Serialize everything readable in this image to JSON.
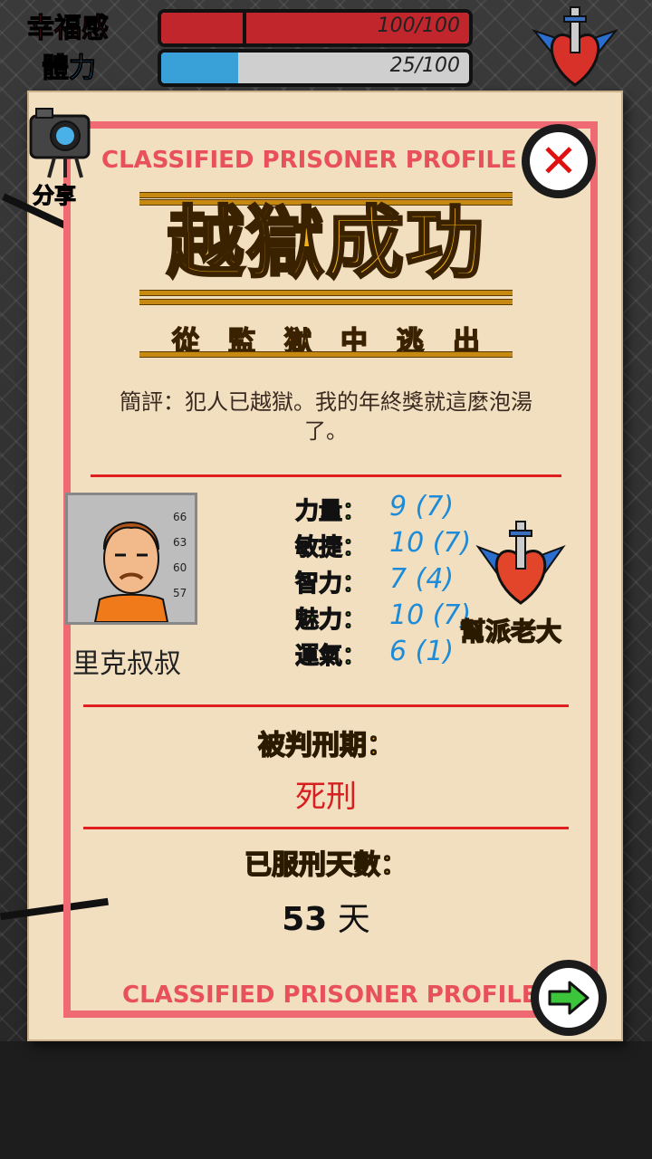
{
  "hud": {
    "stats": [
      {
        "label": "幸福感",
        "value_text": "100/100",
        "fraction": 1.0,
        "color": "#c0262c"
      },
      {
        "label": "體力",
        "value_text": "25/100",
        "fraction": 0.25,
        "color": "#3aa0d8"
      }
    ]
  },
  "toolbar": {
    "share_label": "分享"
  },
  "card": {
    "header": "CLASSIFIED PRISONER PROFILE",
    "footer": "CLASSIFIED PRISONER PROFILE",
    "title": "越獄成功",
    "subtitle": "從監獄中逃出",
    "comment": "簡評：犯人已越獄。我的年終獎就這麼泡湯了。",
    "prisoner_name": "里克叔叔",
    "mugshot_marks": [
      "66",
      "63",
      "60",
      "57"
    ],
    "stats": [
      {
        "label": "力量：",
        "value": "9 (7)"
      },
      {
        "label": "敏捷：",
        "value": "10 (7)"
      },
      {
        "label": "智力：",
        "value": "7 (4)"
      },
      {
        "label": "魅力：",
        "value": "10 (7)"
      },
      {
        "label": "運氣：",
        "value": "6 (1)"
      }
    ],
    "gang_title": "幫派老大",
    "sentence_heading": "被判刑期：",
    "sentence_value": "死刑",
    "days_heading": "已服刑天數：",
    "days_value": "53",
    "days_unit": "天"
  },
  "colors": {
    "frame": "#f06a74",
    "paper": "#f2dfc0",
    "gold": "#f3b21a",
    "stat_label": "#6fc02a",
    "stat_value": "#1e8bd8"
  }
}
